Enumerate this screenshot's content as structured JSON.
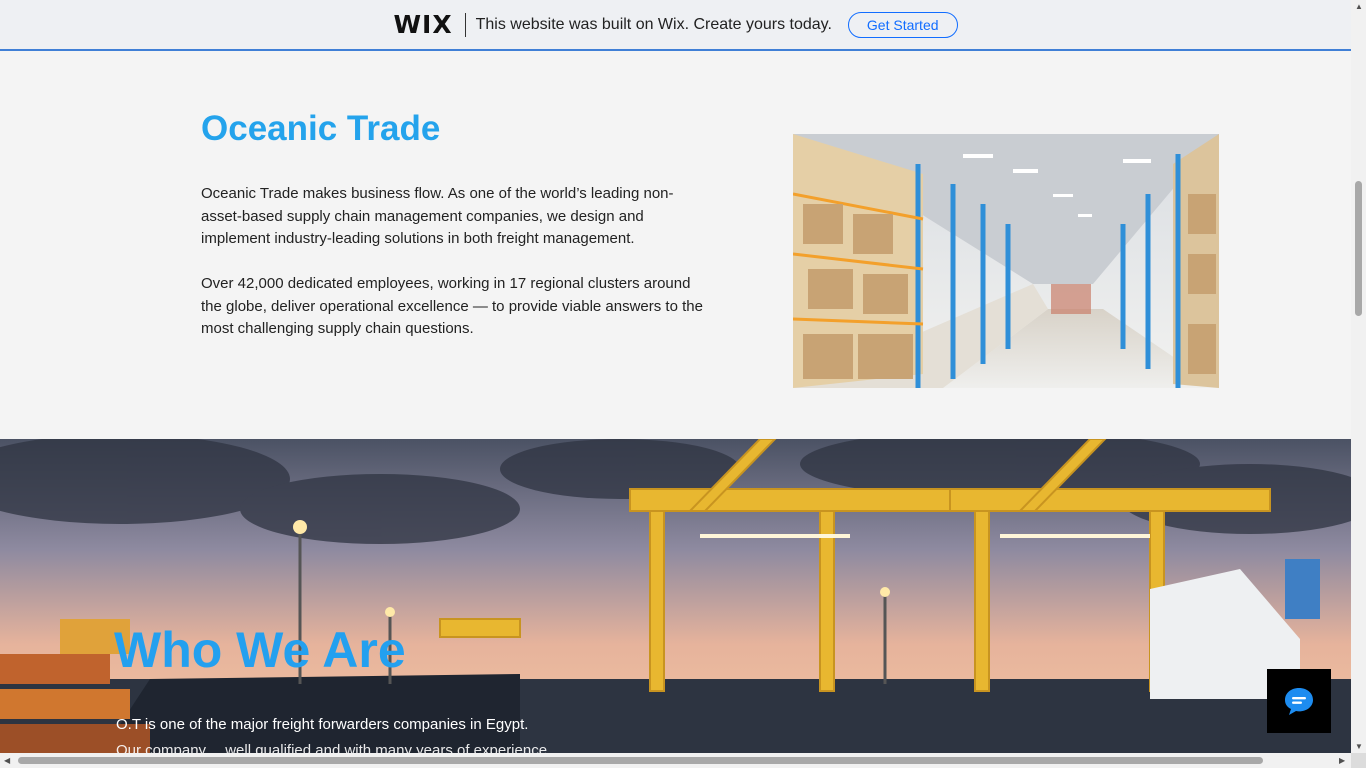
{
  "wix_banner": {
    "logo": "WIX",
    "message": "This website was built on Wix. Create yours today.",
    "cta": "Get Started"
  },
  "about": {
    "title": "Oceanic Trade",
    "paragraph1": "Oceanic Trade makes business flow. As one of the world’s leading non-asset-based supply chain management companies, we design and implement industry-leading solutions in both freight management.",
    "paragraph2": "Over 42,000 dedicated employees, working in 17 regional clusters around the globe, deliver operational excellence — to provide viable answers to the most challenging supply chain questions."
  },
  "who_we_are": {
    "title": "Who We Are",
    "line1": "O.T is one of the major freight forwarders companies in Egypt.",
    "line2": "Our company… well qualified and with many years of experience…"
  },
  "chat": {
    "icon": "chat-bubble-icon"
  },
  "colors": {
    "accent": "#24a3ec",
    "wix_blue": "#116dff"
  }
}
